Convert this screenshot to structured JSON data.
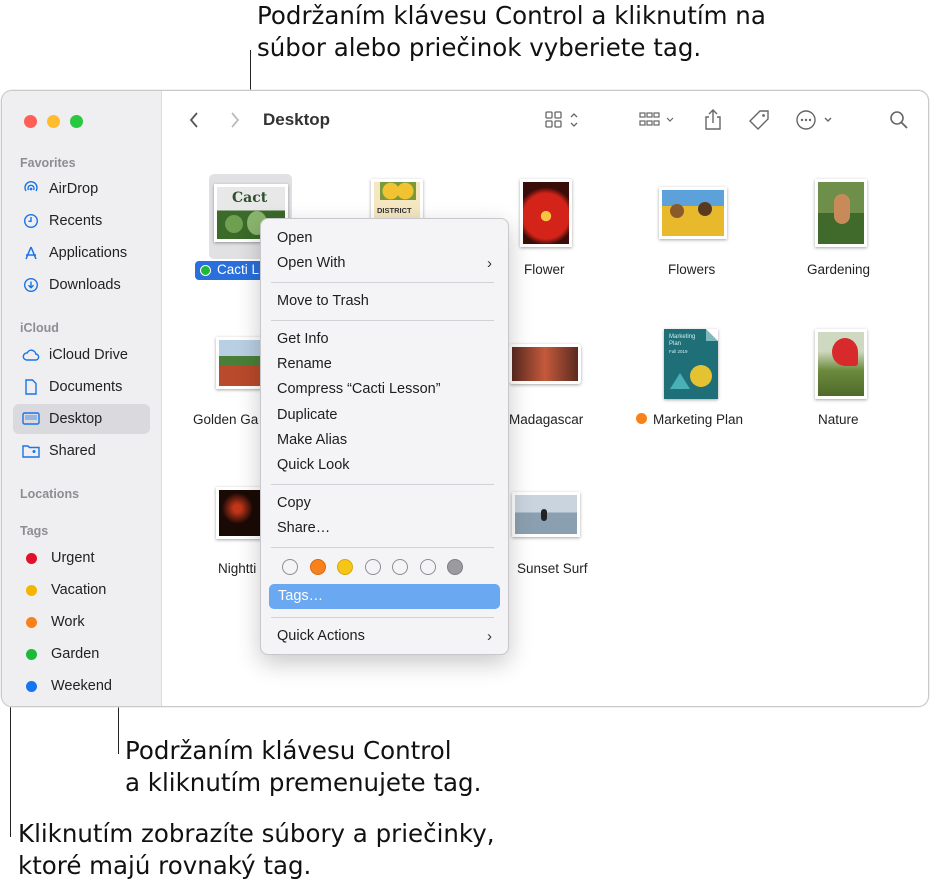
{
  "callouts": {
    "top_line1": "Podržaním klávesu Control a kliknutím na",
    "top_line2": "súbor alebo priečinok vyberiete tag.",
    "rename_line1": "Podržaním klávesu Control",
    "rename_line2": "a kliknutím premenujete tag.",
    "show_line1": "Kliknutím zobrazíte súbory a priečinky,",
    "show_line2": "ktoré majú rovnaký tag."
  },
  "window": {
    "title": "Desktop",
    "traffic": {
      "close": "#ff5f57",
      "minimize": "#febc2e",
      "zoom": "#28c840"
    }
  },
  "sidebar": {
    "favorites_header": "Favorites",
    "favorites": [
      {
        "label": "AirDrop",
        "icon": "airdrop-icon"
      },
      {
        "label": "Recents",
        "icon": "clock-icon"
      },
      {
        "label": "Applications",
        "icon": "applications-icon"
      },
      {
        "label": "Downloads",
        "icon": "download-icon"
      }
    ],
    "icloud_header": "iCloud",
    "icloud": [
      {
        "label": "iCloud Drive",
        "icon": "cloud-icon"
      },
      {
        "label": "Documents",
        "icon": "document-icon"
      },
      {
        "label": "Desktop",
        "icon": "desktop-icon",
        "selected": true
      },
      {
        "label": "Shared",
        "icon": "shared-folder-icon"
      }
    ],
    "locations_header": "Locations",
    "tags_header": "Tags",
    "tags": [
      {
        "label": "Urgent",
        "color": "#e0112b"
      },
      {
        "label": "Vacation",
        "color": "#f5b400"
      },
      {
        "label": "Work",
        "color": "#f7821b"
      },
      {
        "label": "Garden",
        "color": "#1eb937"
      },
      {
        "label": "Weekend",
        "color": "#1674f0"
      }
    ]
  },
  "files": [
    {
      "name": "Cacti L",
      "selected": true,
      "tag_color": "#1eb937"
    },
    {
      "name": "Flower"
    },
    {
      "name": "Flowers"
    },
    {
      "name": "Gardening"
    },
    {
      "name": "Golden Ga"
    },
    {
      "name": "Madagascar"
    },
    {
      "name": "Marketing Plan",
      "tag_color": "#f7821b"
    },
    {
      "name": "Nature"
    },
    {
      "name": "Nightti"
    },
    {
      "name": "Sunset Surf"
    }
  ],
  "thumb_text": {
    "cacti": "Cact",
    "district": "DISTRICT",
    "marketing": "Marketing Plan",
    "marketing_sub": "Fall 2019"
  },
  "context_menu": {
    "open": "Open",
    "open_with": "Open With",
    "move_to_trash": "Move to Trash",
    "get_info": "Get Info",
    "rename": "Rename",
    "compress": "Compress “Cacti Lesson”",
    "duplicate": "Duplicate",
    "make_alias": "Make Alias",
    "quick_look": "Quick Look",
    "copy": "Copy",
    "share": "Share…",
    "tags": "Tags…",
    "quick_actions": "Quick Actions",
    "tag_colors": [
      "none",
      "#f7821b",
      "#f5c518",
      "none",
      "none",
      "none",
      "#8e8e93"
    ],
    "highlight": "#6aa8f2"
  }
}
